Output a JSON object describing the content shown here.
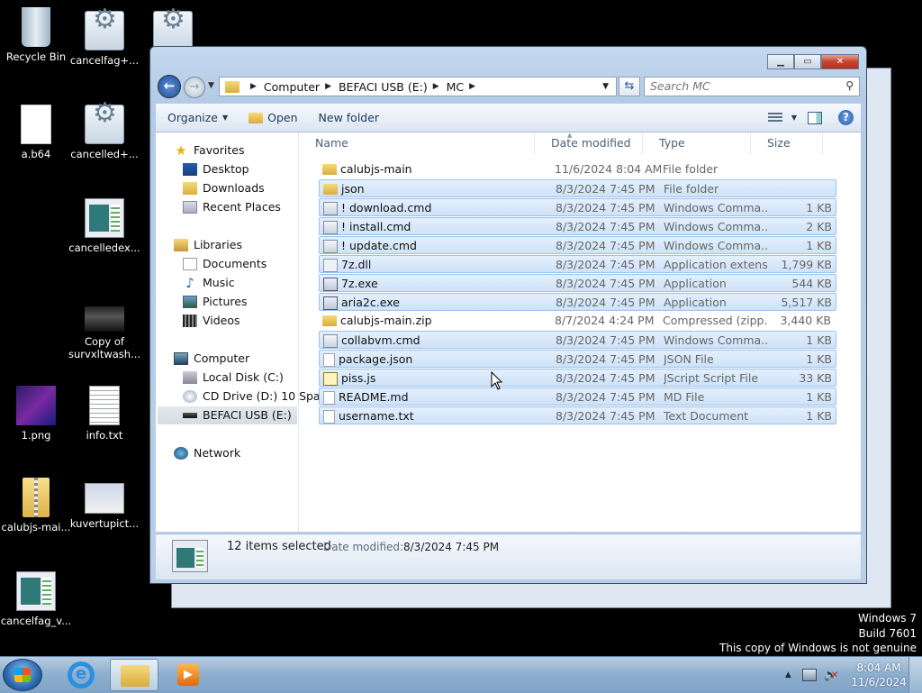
{
  "desktop": {
    "icons": [
      {
        "label": "Recycle Bin"
      },
      {
        "label": "cancelfag+..."
      },
      {
        "label": "a.b64"
      },
      {
        "label": "cancelled+..."
      },
      {
        "label": "cancelledex..."
      },
      {
        "label": "Copy of survxltwash..."
      },
      {
        "label": "1.png"
      },
      {
        "label": "info.txt"
      },
      {
        "label": "calubjs-mai..."
      },
      {
        "label": "kuvertupict..."
      },
      {
        "label": "cancelfag_v..."
      }
    ]
  },
  "window": {
    "address": {
      "crumbs": [
        "Computer",
        "BEFACI USB (E:)",
        "MC"
      ],
      "search_placeholder": "Search MC"
    },
    "toolbar": {
      "organize": "Organize",
      "open": "Open",
      "new_folder": "New folder"
    },
    "nav": {
      "favorites": "Favorites",
      "desktop": "Desktop",
      "downloads": "Downloads",
      "recent": "Recent Places",
      "libraries": "Libraries",
      "documents": "Documents",
      "music": "Music",
      "pictures": "Pictures",
      "videos": "Videos",
      "computer": "Computer",
      "local_disk": "Local Disk (C:)",
      "cd_drive": "CD Drive (D:) 10 Spa",
      "usb": "BEFACI USB (E:)",
      "network": "Network"
    },
    "columns": {
      "name": "Name",
      "date": "Date modified",
      "type": "Type",
      "size": "Size"
    },
    "files": [
      {
        "name": "calubjs-main",
        "date": "11/6/2024 8:04 AM",
        "type": "File folder",
        "size": "",
        "icon": "folder-icon",
        "selected": false
      },
      {
        "name": "json",
        "date": "8/3/2024 7:45 PM",
        "type": "File folder",
        "size": "",
        "icon": "folder-icon",
        "selected": true
      },
      {
        "name": "! download.cmd",
        "date": "8/3/2024 7:45 PM",
        "type": "Windows Comma...",
        "size": "1 KB",
        "icon": "cmd-file-icon",
        "selected": true
      },
      {
        "name": "! install.cmd",
        "date": "8/3/2024 7:45 PM",
        "type": "Windows Comma...",
        "size": "2 KB",
        "icon": "cmd-file-icon",
        "selected": true
      },
      {
        "name": "! update.cmd",
        "date": "8/3/2024 7:45 PM",
        "type": "Windows Comma...",
        "size": "1 KB",
        "icon": "cmd-file-icon",
        "selected": true
      },
      {
        "name": "7z.dll",
        "date": "8/3/2024 7:45 PM",
        "type": "Application extens...",
        "size": "1,799 KB",
        "icon": "dll-file-icon",
        "selected": true
      },
      {
        "name": "7z.exe",
        "date": "8/3/2024 7:45 PM",
        "type": "Application",
        "size": "544 KB",
        "icon": "exe-file-icon",
        "selected": true
      },
      {
        "name": "aria2c.exe",
        "date": "8/3/2024 7:45 PM",
        "type": "Application",
        "size": "5,517 KB",
        "icon": "exe-file-icon",
        "selected": true
      },
      {
        "name": "calubjs-main.zip",
        "date": "8/7/2024 4:24 PM",
        "type": "Compressed (zipp...",
        "size": "3,440 KB",
        "icon": "zip-folder-icon",
        "selected": false
      },
      {
        "name": "collabvm.cmd",
        "date": "8/3/2024 7:45 PM",
        "type": "Windows Comma...",
        "size": "1 KB",
        "icon": "cmd-file-icon",
        "selected": true
      },
      {
        "name": "package.json",
        "date": "8/3/2024 7:45 PM",
        "type": "JSON File",
        "size": "1 KB",
        "icon": "document-icon",
        "selected": true
      },
      {
        "name": "piss.js",
        "date": "8/3/2024 7:45 PM",
        "type": "JScript Script File",
        "size": "33 KB",
        "icon": "js-file-icon",
        "selected": true
      },
      {
        "name": "README.md",
        "date": "8/3/2024 7:45 PM",
        "type": "MD File",
        "size": "1 KB",
        "icon": "document-icon",
        "selected": true
      },
      {
        "name": "username.txt",
        "date": "8/3/2024 7:45 PM",
        "type": "Text Document",
        "size": "1 KB",
        "icon": "document-icon",
        "selected": true
      }
    ],
    "details": {
      "count": "12 items selected",
      "date_label": "Date modified:",
      "date_value": "8/3/2024 7:45 PM"
    }
  },
  "watermark": {
    "line1": "Windows 7",
    "line2": "Build 7601",
    "line3": "This copy of Windows is not genuine"
  },
  "taskbar": {
    "time": "8:04 AM",
    "date": "11/6/2024"
  }
}
